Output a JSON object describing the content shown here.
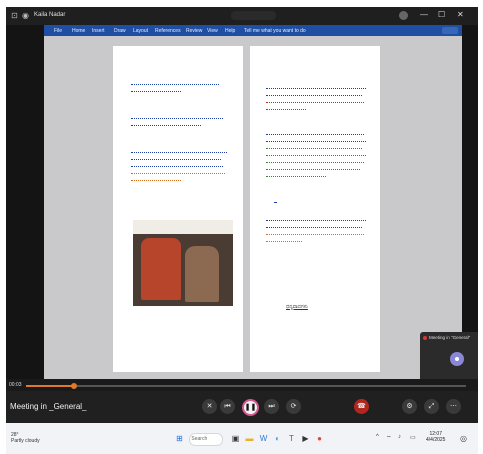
{
  "window": {
    "title": "Kaila Nadar",
    "controls": [
      "—",
      "☐",
      "✕"
    ]
  },
  "ribbon": {
    "menus": [
      "File",
      "Home",
      "Insert",
      "Draw",
      "Layout",
      "References",
      "Review",
      "View",
      "Help",
      "Tell me what you want to do"
    ]
  },
  "document": {
    "left_paragraphs": [
      {
        "bullet": "➤",
        "lines": 2,
        "accent": ""
      },
      {
        "bullet": "➤",
        "lines": 2,
        "accent": ""
      },
      {
        "bullet": "➤",
        "lines": 5,
        "accent": "orange"
      }
    ],
    "right_paragraphs": [
      {
        "bullet": "➤",
        "lines": 4,
        "accent": "red"
      },
      {
        "bullet": "➤",
        "lines": 7,
        "accent": "green"
      },
      {
        "bullet": "•",
        "lines": 0,
        "accent": ""
      },
      {
        "bullet": "➤",
        "lines": 4,
        "accent": "orange"
      }
    ],
    "signature": "ಧನ್ಯವಾದಗಳು"
  },
  "participant_tile": {
    "header": "Meeting in \"General\"",
    "buttons": [
      "⋯",
      "🎤",
      "📞"
    ]
  },
  "seekbar": {
    "elapsed": "00:03",
    "progress": 0.11
  },
  "meeting": {
    "name": "Meeting in _General_",
    "buttons": [
      "camera-off",
      "previous",
      "rewind",
      "pause",
      "forward",
      "next",
      "leave",
      "more"
    ]
  },
  "taskbar": {
    "weather_temp": "28°",
    "weather_desc": "Partly cloudy",
    "search_placeholder": "Search",
    "time": "12:07",
    "date": "4/4/2025"
  },
  "colors": {
    "ribbon": "#1e4fa3",
    "accent_orange": "#e07a2a",
    "end_call": "#b3261e"
  }
}
